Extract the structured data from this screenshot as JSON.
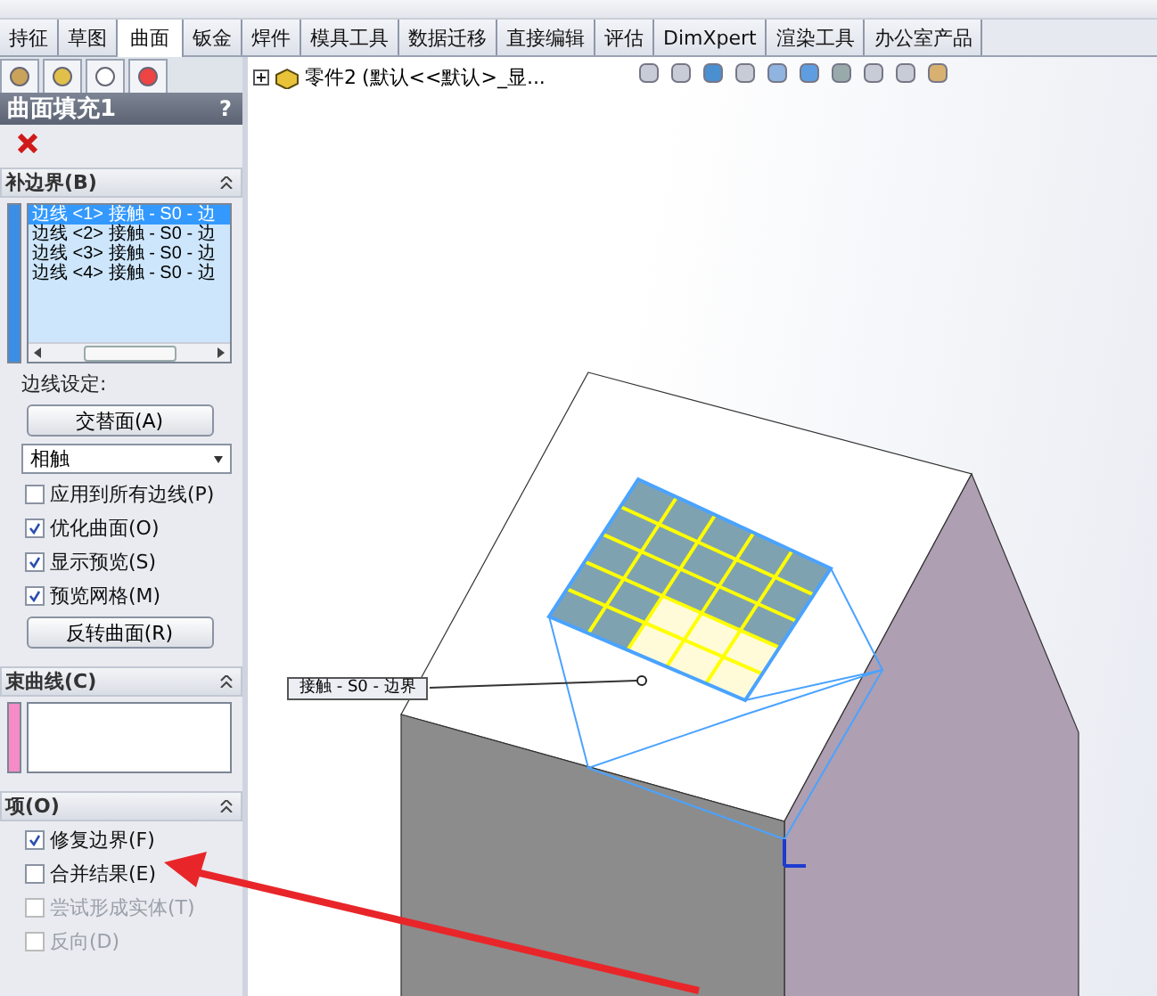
{
  "tabs": [
    {
      "label": "持征",
      "selected": false
    },
    {
      "label": "草图",
      "selected": false
    },
    {
      "label": "曲面",
      "selected": true
    },
    {
      "label": "钣金",
      "selected": false
    },
    {
      "label": "焊件",
      "selected": false
    },
    {
      "label": "模具工具",
      "selected": false
    },
    {
      "label": "数据迁移",
      "selected": false
    },
    {
      "label": "直接编辑",
      "selected": false
    },
    {
      "label": "评估",
      "selected": false
    },
    {
      "label": "DimXpert",
      "selected": false
    },
    {
      "label": "渲染工具",
      "selected": false
    },
    {
      "label": "办公室产品",
      "selected": false
    }
  ],
  "panel": {
    "title": "曲面填充1",
    "help": "?",
    "sections": [
      {
        "kind": "boundary",
        "title": "补边界(B)",
        "expanded": true,
        "items": [
          {
            "label": "边线 <1> 接触 - S0 - 边",
            "selected": true
          },
          {
            "label": "边线 <2> 接触 - S0 - 边",
            "selected": false
          },
          {
            "label": "边线 <3> 接触 - S0 - 边",
            "selected": false
          },
          {
            "label": "边线 <4> 接触 - S0 - 边",
            "selected": false
          }
        ],
        "settings_label": "边线设定:",
        "button": "交替面(A)",
        "dropdown": "相触",
        "checkboxes": [
          {
            "label": "应用到所有边线(P)",
            "checked": false,
            "disabled": false
          },
          {
            "label": "优化曲面(O)",
            "checked": true,
            "disabled": false
          },
          {
            "label": "显示预览(S)",
            "checked": true,
            "disabled": false
          },
          {
            "label": "预览网格(M)",
            "checked": true,
            "disabled": false
          }
        ],
        "button2": "反转曲面(R)"
      },
      {
        "kind": "curves",
        "title": "束曲线(C)",
        "expanded": true
      },
      {
        "kind": "options",
        "title": "项(O)",
        "expanded": true,
        "checkboxes": [
          {
            "label": "修复边界(F)",
            "checked": true,
            "disabled": false
          },
          {
            "label": "合并结果(E)",
            "checked": false,
            "disabled": false
          },
          {
            "label": "尝试形成实体(T)",
            "checked": false,
            "disabled": true
          },
          {
            "label": "反向(D)",
            "checked": false,
            "disabled": true
          }
        ]
      }
    ]
  },
  "viewport": {
    "tree_item": "零件2",
    "tree_detail": "(默认<<默认>_显...",
    "callout": "接触 - S0 - 边界"
  }
}
